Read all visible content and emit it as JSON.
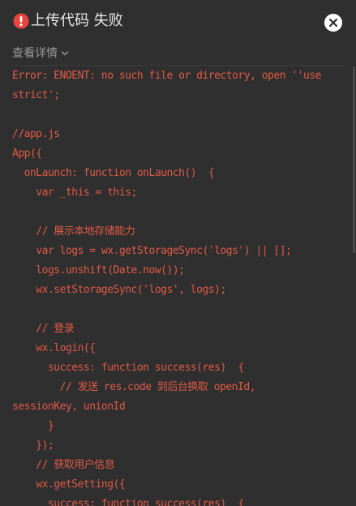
{
  "dialog": {
    "title": "上传代码 失败",
    "details_label": "查看详情",
    "colors": {
      "background": "#2f2f2f",
      "error_text": "#e05a47",
      "warning_icon": "#e8453c"
    },
    "icons": {
      "warning": "warning-circle-icon",
      "close": "close-icon",
      "chevron": "chevron-down-icon"
    }
  },
  "code_lines": [
    "Error: ENOENT: no such file or directory, open ''use",
    "strict';",
    "",
    "//app.js",
    "App({",
    "  onLaunch: function onLaunch()  {",
    "    var _this = this;",
    "",
    "    // 展示本地存储能力",
    "    var logs = wx.getStorageSync('logs') || [];",
    "    logs.unshift(Date.now());",
    "    wx.setStorageSync('logs', logs);",
    "",
    "    // 登录",
    "    wx.login({",
    "      success: function success(res)  {",
    "        // 发送 res.code 到后台换取 openId,",
    "sessionKey, unionId",
    "      }",
    "    });",
    "    // 获取用户信息",
    "    wx.getSetting({",
    "      success: function success(res)  {"
  ]
}
